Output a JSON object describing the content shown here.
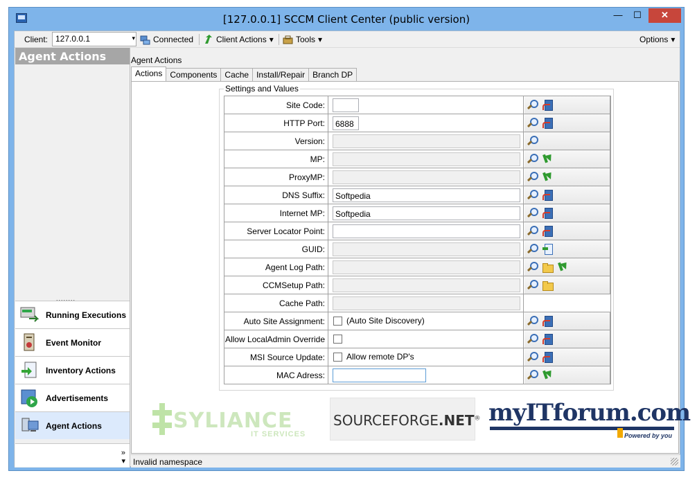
{
  "window": {
    "title": "[127.0.0.1] SCCM Client Center (public version)",
    "min": "—",
    "max": "☐",
    "close": "✕"
  },
  "toolbar": {
    "client_label": "Client:",
    "client_value": "127.0.0.1",
    "connected_label": "Connected",
    "client_actions_label": "Client Actions",
    "tools_label": "Tools",
    "options_label": "Options",
    "dropdown_arrow": "▾"
  },
  "left_panel": {
    "header": "Agent Actions",
    "grip": "........",
    "nav": [
      {
        "label": "Running Executions"
      },
      {
        "label": "Event Monitor"
      },
      {
        "label": "Inventory Actions"
      },
      {
        "label": "Advertisements"
      },
      {
        "label": "Agent Actions"
      }
    ],
    "more": "»",
    "more_arrow": "▾"
  },
  "main": {
    "section_label": "Agent Actions",
    "tabs": [
      "Actions",
      "Components",
      "Cache",
      "Install/Repair",
      "Branch DP"
    ],
    "group_title": "Settings and Values",
    "rows": [
      {
        "label": "Site Code:",
        "value": ""
      },
      {
        "label": "HTTP Port:",
        "value": "6888"
      },
      {
        "label": "Version:",
        "value": ""
      },
      {
        "label": "MP:",
        "value": ""
      },
      {
        "label": "ProxyMP:",
        "value": ""
      },
      {
        "label": "DNS Suffix:",
        "value": "Softpedia"
      },
      {
        "label": "Internet MP:",
        "value": "Softpedia"
      },
      {
        "label": "Server Locator Point:",
        "value": ""
      },
      {
        "label": "GUID:",
        "value": ""
      },
      {
        "label": "Agent Log Path:",
        "value": ""
      },
      {
        "label": "CCMSetup Path:",
        "value": ""
      },
      {
        "label": "Cache Path:",
        "value": ""
      },
      {
        "label": "Auto Site Assignment:",
        "value": "(Auto Site Discovery)"
      },
      {
        "label": "Allow LocalAdmin Override",
        "value": ""
      },
      {
        "label": "MSI Source Update:",
        "value": "Allow remote DP's"
      },
      {
        "label": "MAC Adress:",
        "value": ""
      }
    ]
  },
  "logos": {
    "syliance": "SYLIANCE",
    "syliance_sub": "IT SERVICES",
    "sourceforge_a": "SOURCEFORGE",
    "sourceforge_b": ".NET",
    "sourceforge_reg": "®",
    "myitforum": "myITforum.com",
    "myitforum_tag": "Powered by you"
  },
  "status": {
    "text": "Invalid namespace"
  },
  "colors": {
    "titlebar": "#7eb4ea",
    "close_button": "#c7463b",
    "panel_header": "#a6a6a6",
    "active_nav": "#dceafc"
  }
}
